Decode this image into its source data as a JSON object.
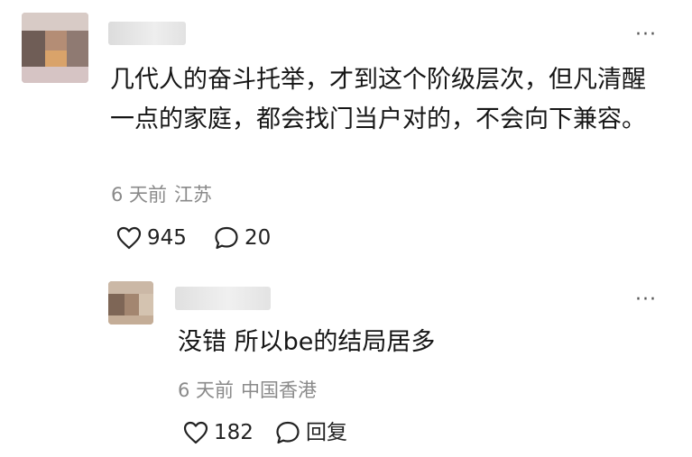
{
  "comment": {
    "body": "几代人的奋斗托举，才到这个阶级层次，但凡清醒一点的家庭，都会找门当户对的，不会向下兼容。",
    "time": "6 天前",
    "location": "江苏",
    "likes": "945",
    "replies": "20",
    "more": "···"
  },
  "reply": {
    "body": "没错 所以be的结局居多",
    "time": "6 天前",
    "location": "中国香港",
    "likes": "182",
    "reply_label": "回复",
    "more": "···"
  },
  "icons": {
    "like": "heart-icon",
    "reply": "speech-bubble-icon",
    "more": "more-dots-icon"
  }
}
